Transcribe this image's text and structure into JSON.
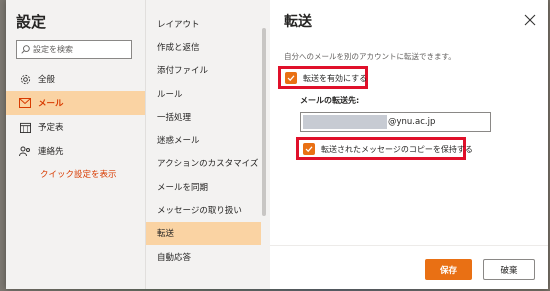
{
  "settings": {
    "title": "設定",
    "search_placeholder": "設定を検索"
  },
  "nav": {
    "items": [
      {
        "label": "全般",
        "icon": "gear-icon"
      },
      {
        "label": "メール",
        "icon": "mail-icon"
      },
      {
        "label": "予定表",
        "icon": "calendar-icon"
      },
      {
        "label": "連絡先",
        "icon": "people-icon"
      }
    ],
    "selected_index": 1,
    "quick_settings_link": "クイック設定を表示"
  },
  "mail_sections": {
    "items": [
      "レイアウト",
      "作成と返信",
      "添付ファイル",
      "ルール",
      "一括処理",
      "迷惑メール",
      "アクションのカスタマイズ",
      "メールを同期",
      "メッセージの取り扱い",
      "転送",
      "自動応答"
    ],
    "selected_index": 9
  },
  "forwarding": {
    "title": "転送",
    "description": "自分へのメールを別のアカウントに転送できます。",
    "enable_label": "転送を有効にする",
    "enable_checked": true,
    "address_label": "メールの転送先:",
    "address_domain": "@ynu.ac.jp",
    "keep_copy_label": "転送されたメッセージのコピーを保持する",
    "keep_copy_checked": true
  },
  "footer": {
    "save_label": "保存",
    "discard_label": "破棄"
  },
  "colors": {
    "accent": "#e97014",
    "selected_bg": "#fad3a3",
    "highlight_frame": "#e0102a"
  }
}
